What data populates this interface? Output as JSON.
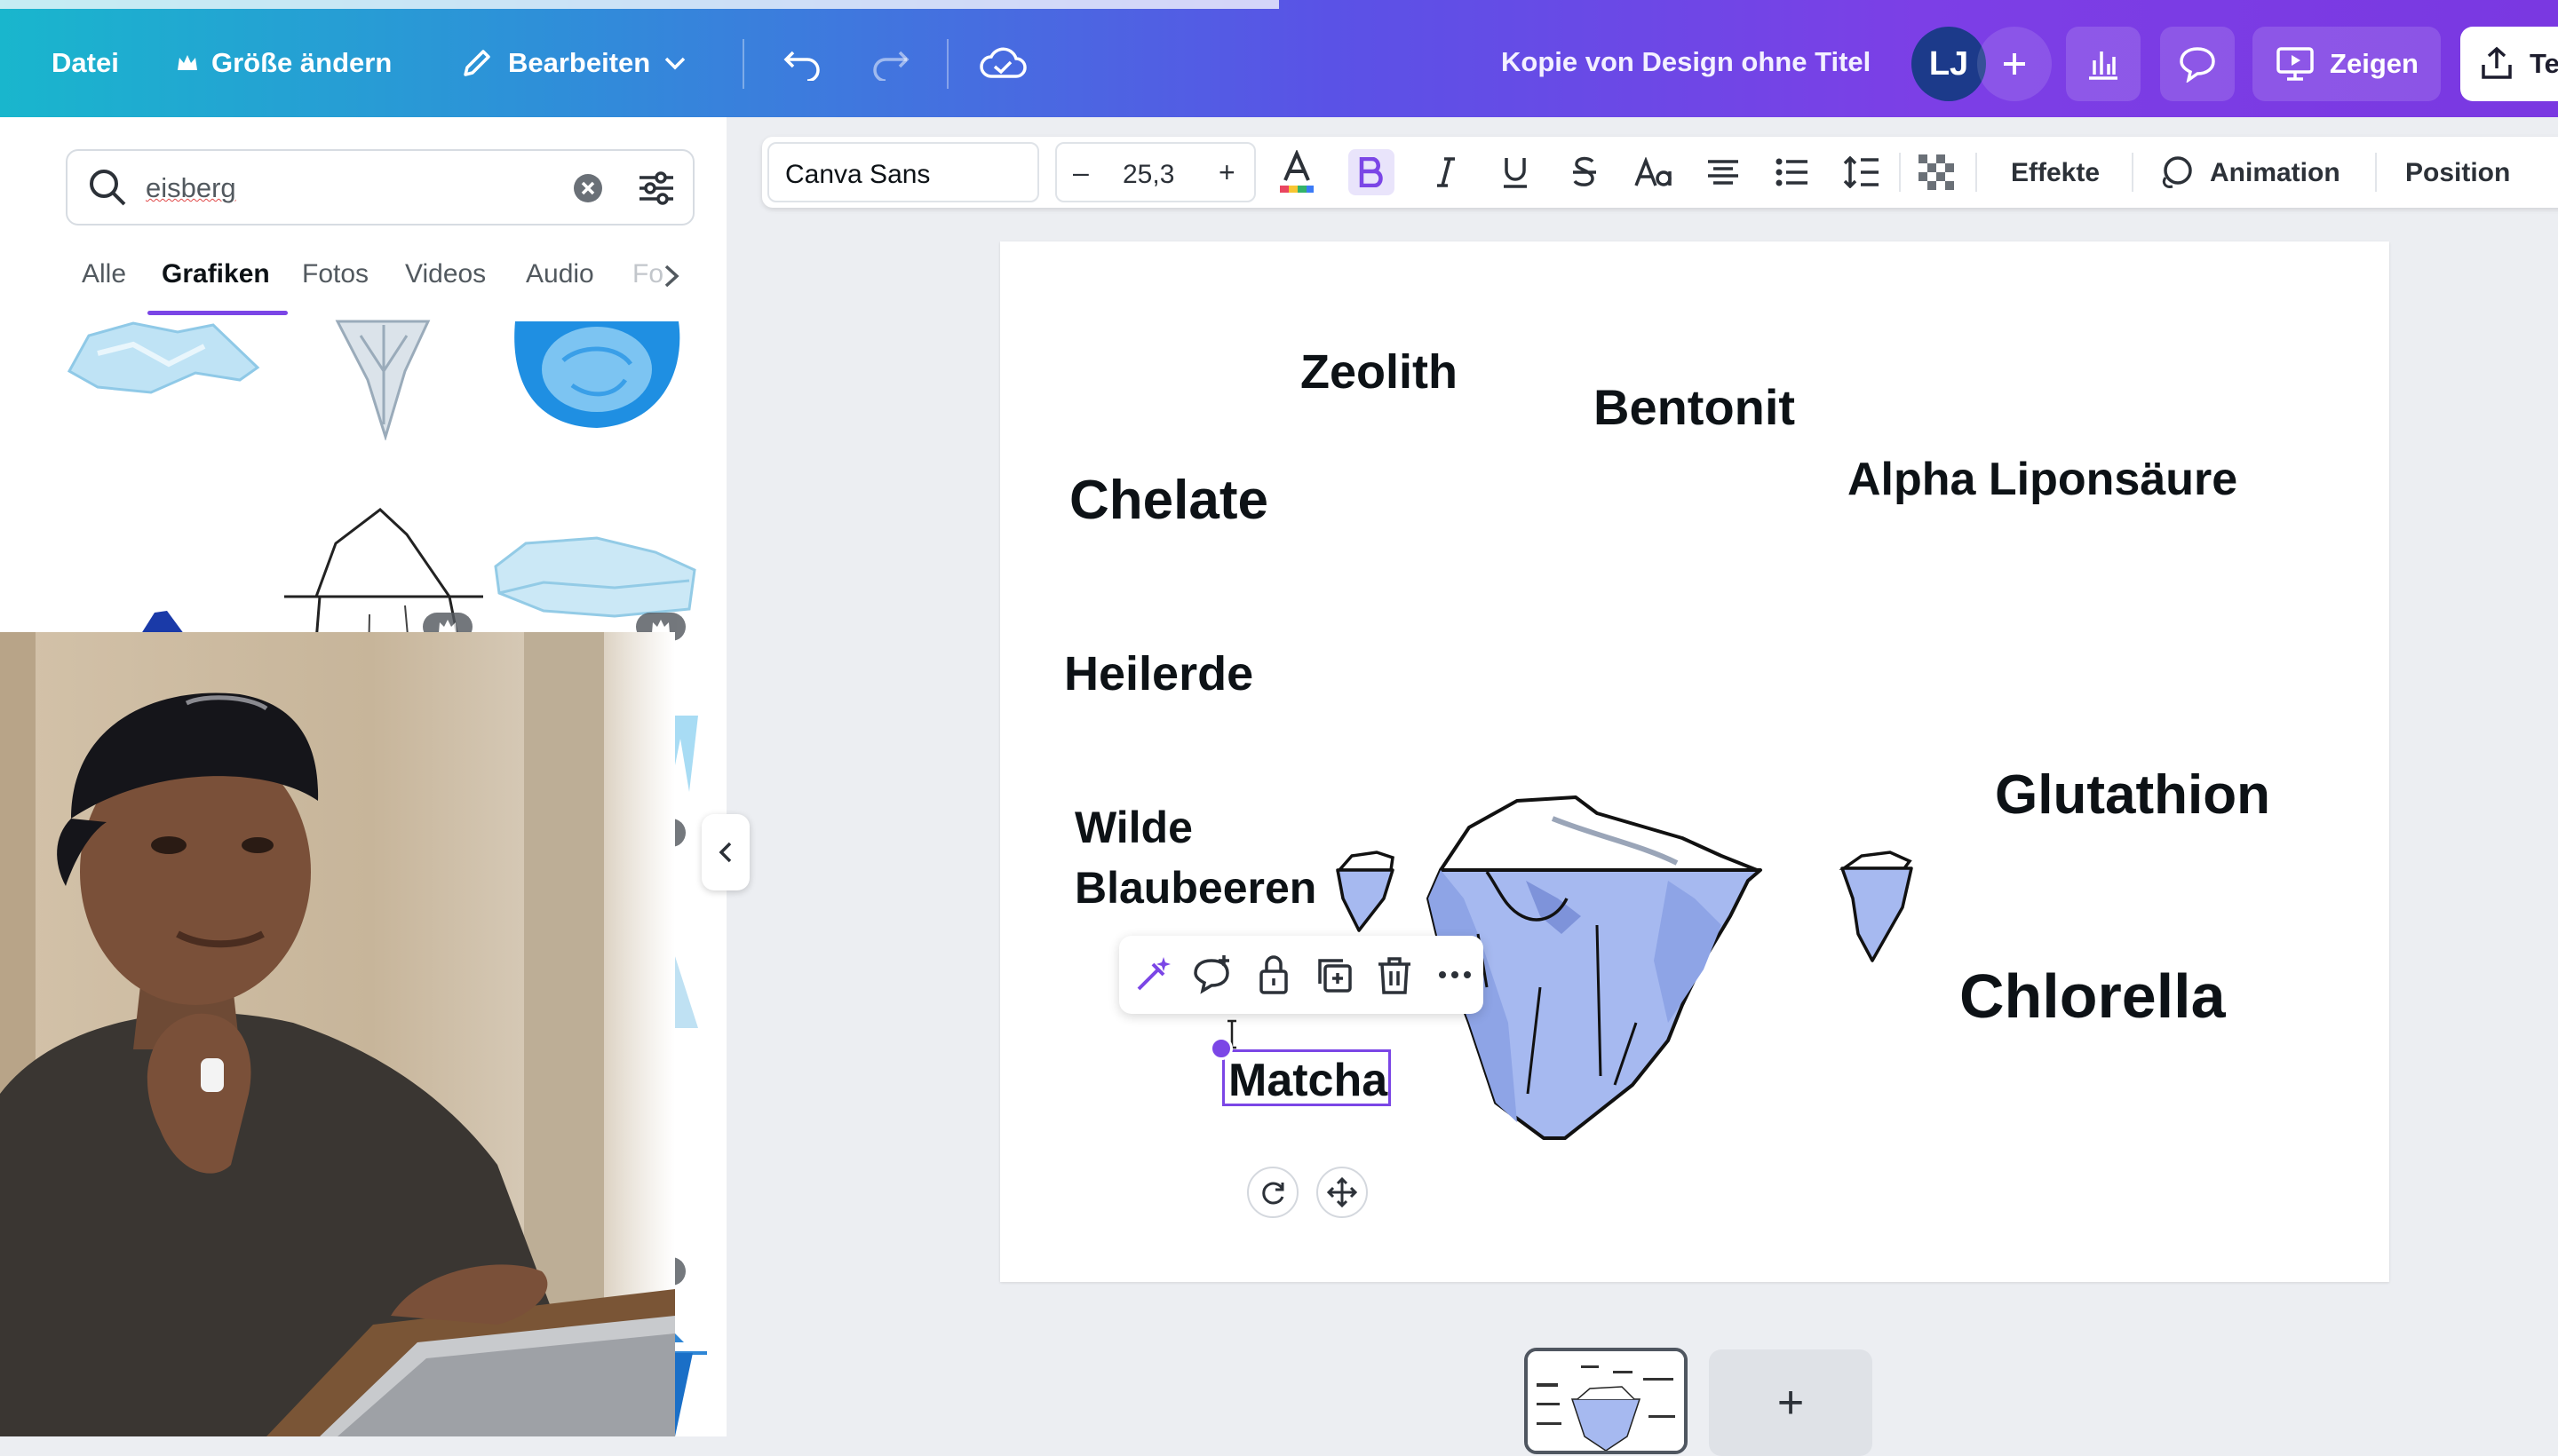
{
  "topbar": {
    "file": "Datei",
    "resize": "Größe ändern",
    "edit": "Bearbeiten",
    "doc_title": "Kopie von Design ohne Titel",
    "avatar_initials": "LJ",
    "present": "Zeigen",
    "share_partial": "Te"
  },
  "panel": {
    "search_value": "eisberg",
    "tabs": [
      "Alle",
      "Grafiken",
      "Fotos",
      "Videos",
      "Audio",
      "Fo"
    ],
    "active_tab": "Grafiken"
  },
  "text_toolbar": {
    "font": "Canva Sans",
    "minus": "–",
    "font_size": "25,3",
    "plus": "+",
    "effects": "Effekte",
    "animation": "Animation",
    "position": "Position"
  },
  "canvas": {
    "labels": {
      "zeolith": "Zeolith",
      "bentonit": "Bentonit",
      "chelate": "Chelate",
      "alpha": "Alpha Liponsäure",
      "heilerde": "Heilerde",
      "glutathion": "Glutathion",
      "wilde_1": "Wilde",
      "wilde_2": "Blaubeeren",
      "chlorella": "Chlorella",
      "matcha": "Matcha"
    }
  },
  "pages": {
    "add": "+"
  },
  "colors": {
    "accent": "#7b46e6",
    "iceberg_fill": "#a6b9f0",
    "iceberg_shade": "#7e93da"
  }
}
